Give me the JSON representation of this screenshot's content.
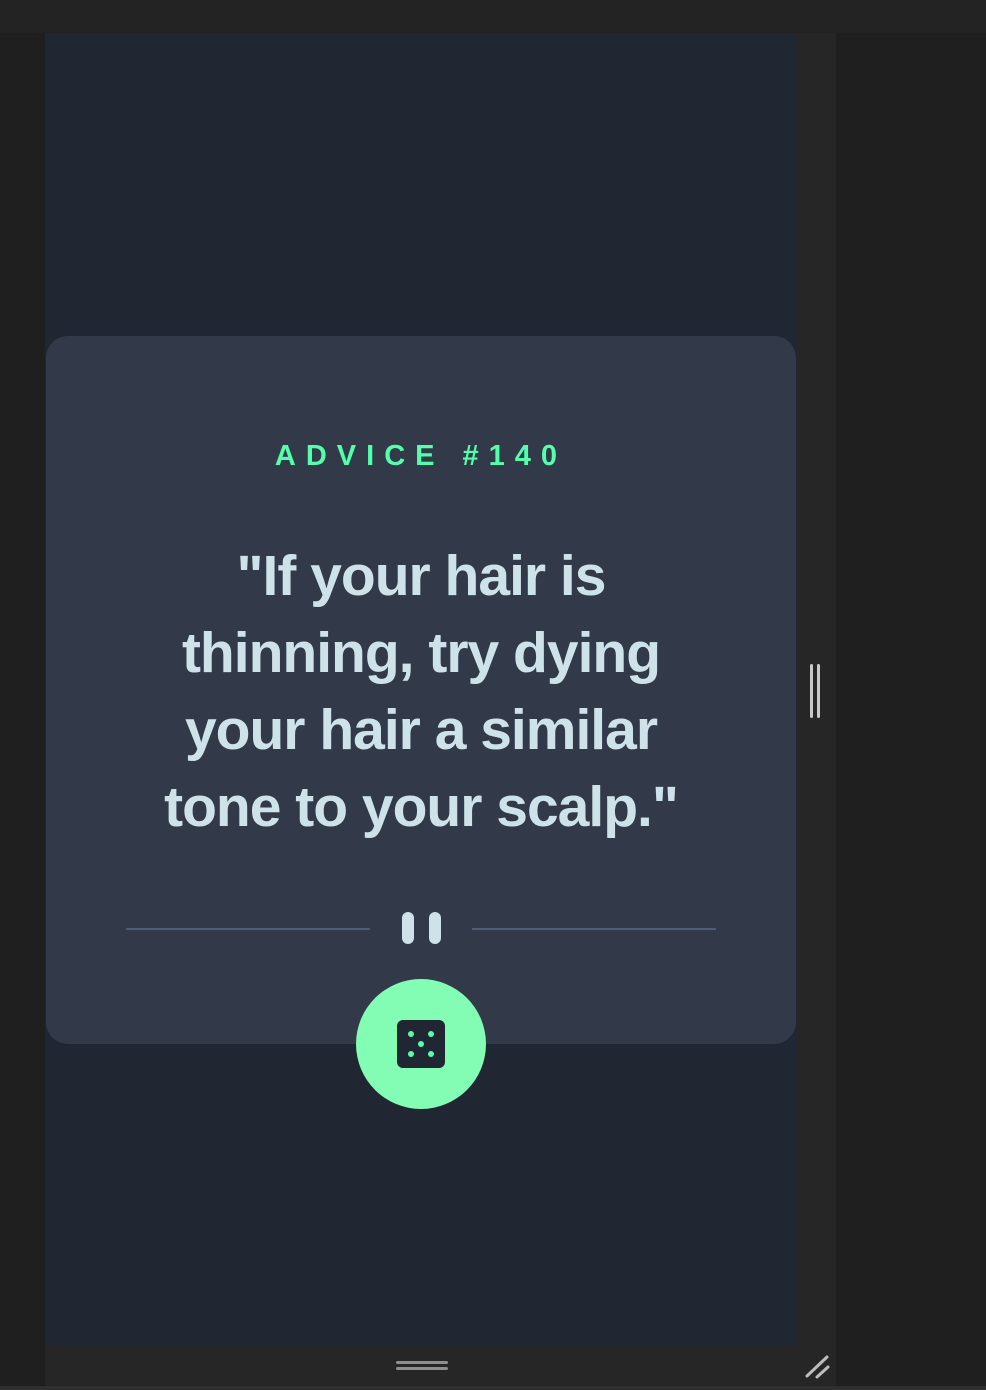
{
  "advice": {
    "id_label": "ADVICE #140",
    "quote": "\"If your hair is thinning, try dying your hair a similar tone to your scalp.\""
  },
  "icons": {
    "pause": "pause-icon",
    "dice": "dice-icon"
  },
  "colors": {
    "accent": "#53ffab",
    "button": "#83fcb4",
    "card": "#323a49",
    "background": "#202632",
    "text": "#cee3e9",
    "divider": "#4f5d74"
  }
}
